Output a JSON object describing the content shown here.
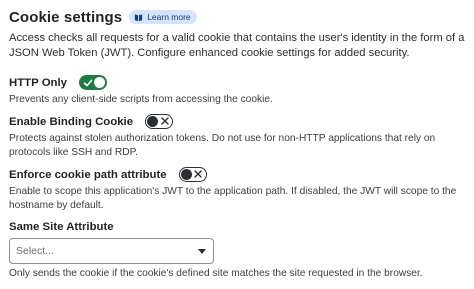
{
  "header": {
    "title": "Cookie settings",
    "learn_more": "Learn more",
    "description": "Access checks all requests for a valid cookie that contains the user's identity in the form of a JSON Web Token (JWT). Configure enhanced cookie settings for added security."
  },
  "settings": [
    {
      "label": "HTTP Only",
      "enabled": true,
      "help": "Prevents any client-side scripts from accessing the cookie."
    },
    {
      "label": "Enable Binding Cookie",
      "enabled": false,
      "help": "Protects against stolen authorization tokens. Do not use for non-HTTP applications that rely on protocols like SSH and RDP."
    },
    {
      "label": "Enforce cookie path attribute",
      "enabled": false,
      "help": "Enable to scope this application's JWT to the application path. If disabled, the JWT will scope to the hostname by default."
    }
  ],
  "same_site": {
    "label": "Same Site Attribute",
    "placeholder": "Select...",
    "help": "Only sends the cookie if the cookie's defined site matches the site requested in the browser."
  },
  "colors": {
    "toggle_on": "#1f7a44",
    "badge_bg": "#d4e4fc",
    "badge_text": "#1a3d73"
  },
  "icons": {
    "learn_more": "book-icon",
    "toggle_on": "check-icon",
    "toggle_off": "x-icon",
    "select": "chevron-down-icon"
  }
}
